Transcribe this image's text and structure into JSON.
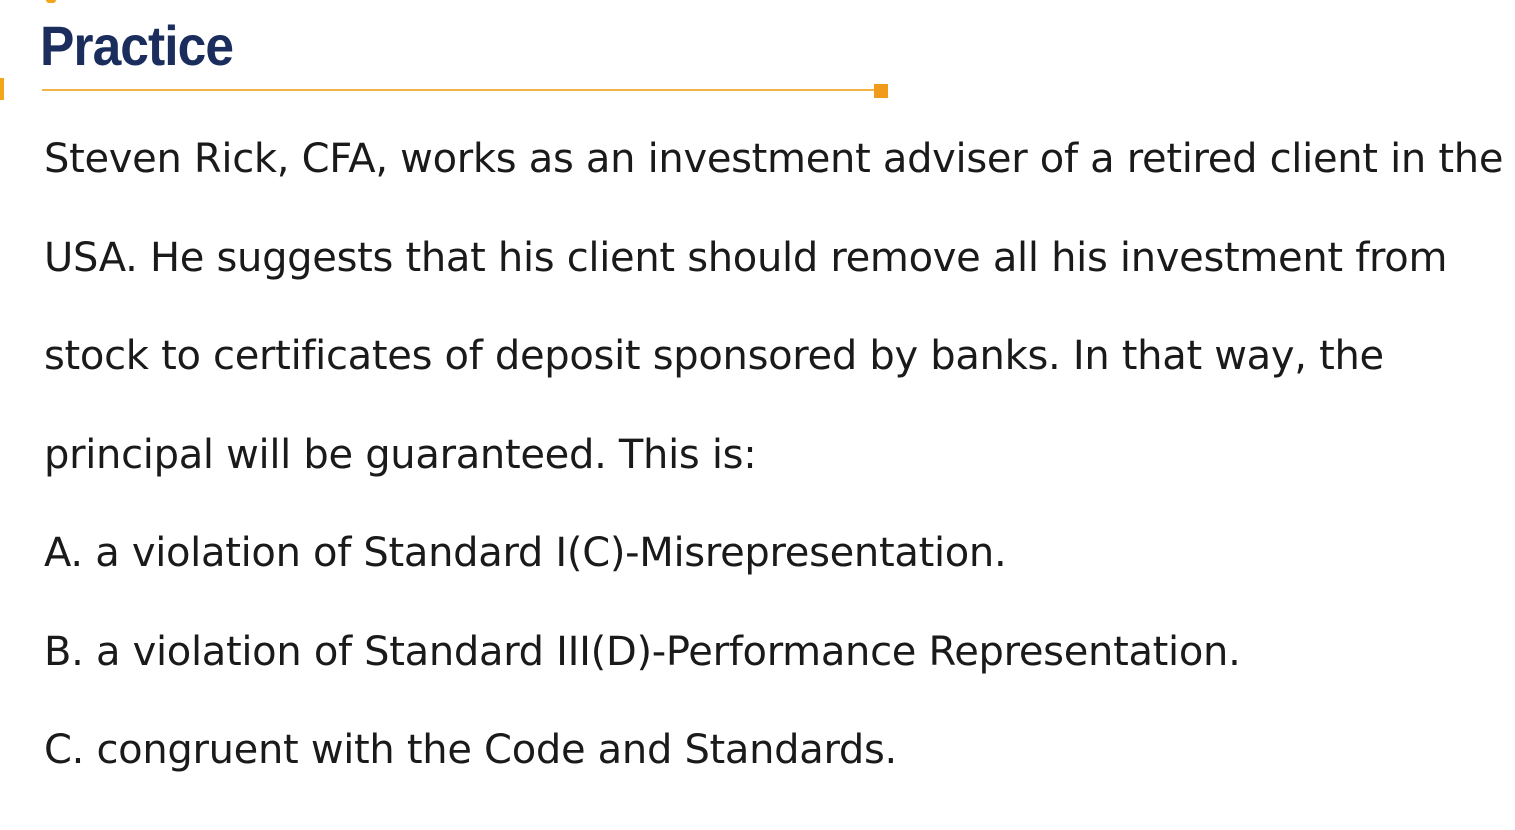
{
  "slide": {
    "title": "Practice",
    "question": "Steven Rick, CFA, works as an investment adviser of a retired client in the USA. He suggests that his client should remove all his investment from stock to certificates of deposit sponsored by banks. In that way, the principal will be guaranteed. This is:",
    "options": [
      {
        "text": "A. a violation of Standard I(C)-Misrepresentation."
      },
      {
        "text": "B. a violation of Standard III(D)-Performance Representation."
      },
      {
        "text": "C. congruent with the Code and Standards."
      }
    ]
  },
  "colors": {
    "title": "#1b2d5c",
    "accent": "#f29a1b",
    "rule": "#f2b44a",
    "body_text": "#1a1a1a"
  }
}
